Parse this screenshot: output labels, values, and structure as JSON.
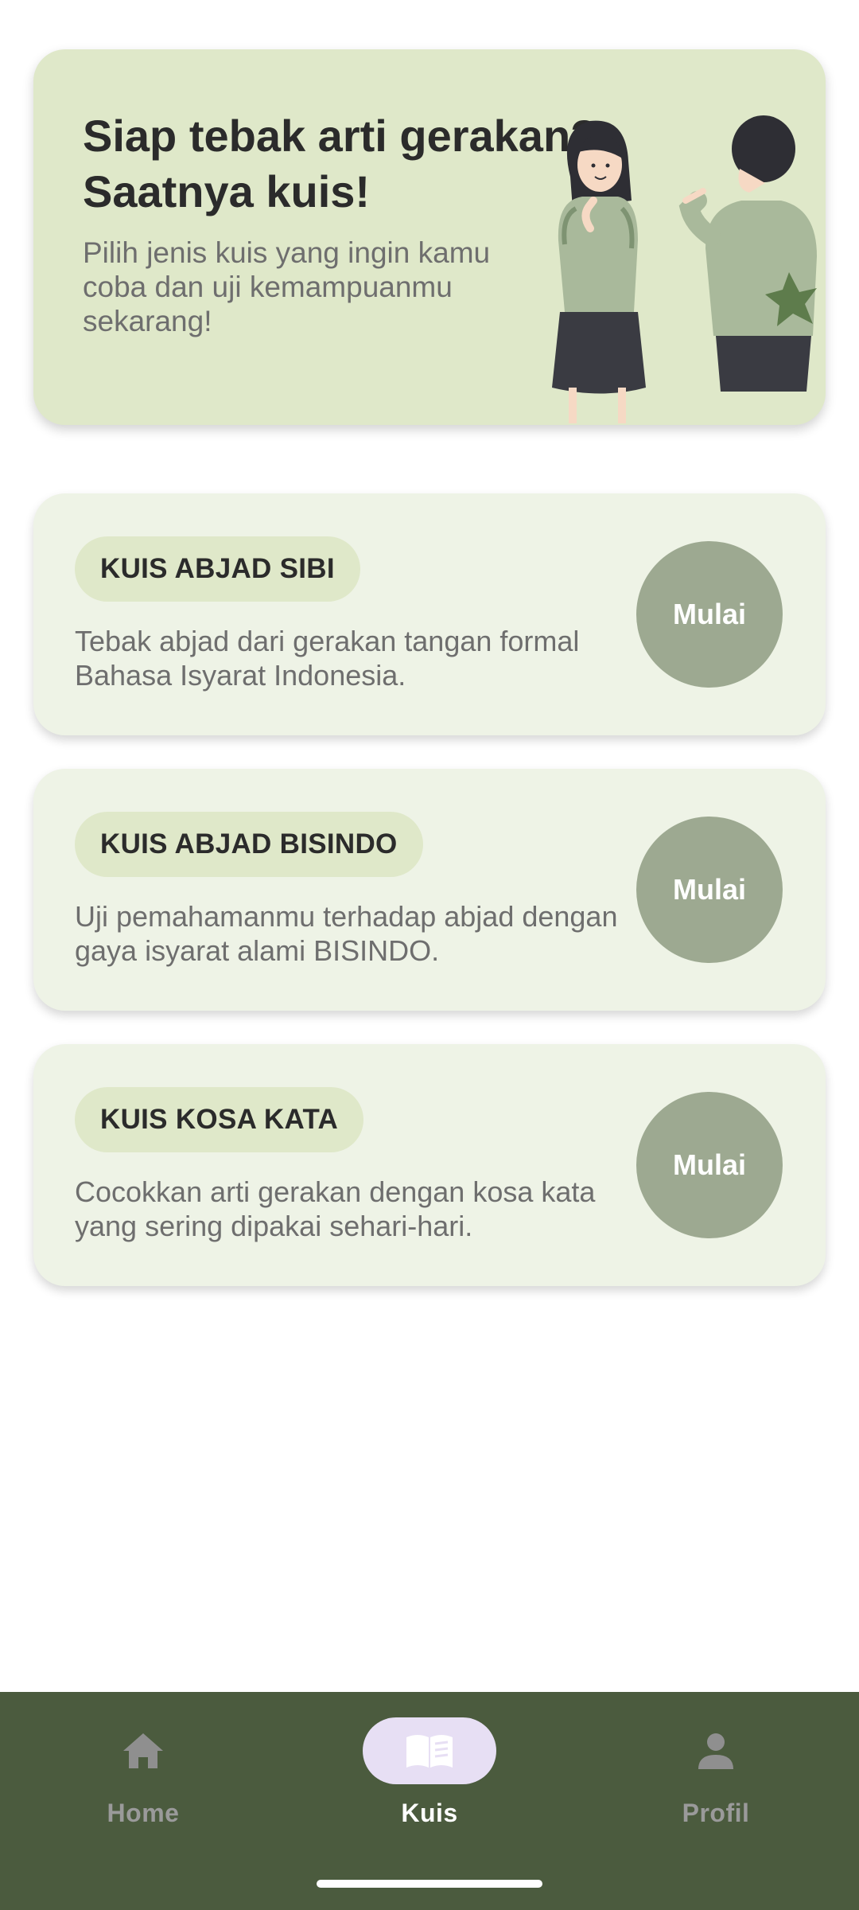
{
  "hero": {
    "title": "Siap tebak arti gerakan?\nSaatnya kuis!",
    "subtitle": "Pilih jenis kuis yang ingin kamu coba dan uji kemampuanmu sekarang!"
  },
  "quizzes": [
    {
      "title": "KUIS ABJAD SIBI",
      "description": "Tebak abjad dari gerakan tangan formal Bahasa Isyarat Indonesia.",
      "button": "Mulai"
    },
    {
      "title": "KUIS ABJAD BISINDO",
      "description": "Uji pemahamanmu terhadap abjad dengan gaya isyarat alami BISINDO.",
      "button": "Mulai"
    },
    {
      "title": "KUIS KOSA KATA",
      "description": "Cocokkan arti gerakan dengan kosa kata yang sering dipakai sehari-hari.",
      "button": "Mulai"
    }
  ],
  "nav": {
    "items": [
      {
        "label": "Home",
        "icon": "home-icon",
        "active": false
      },
      {
        "label": "Kuis",
        "icon": "book-icon",
        "active": true
      },
      {
        "label": "Profil",
        "icon": "person-icon",
        "active": false
      }
    ]
  },
  "colors": {
    "hero_bg": "#dfe8c9",
    "card_bg": "#eef3e6",
    "button_bg": "#9da991",
    "nav_bg": "#4b5b3e",
    "nav_active_indicator": "#e7dff4"
  }
}
